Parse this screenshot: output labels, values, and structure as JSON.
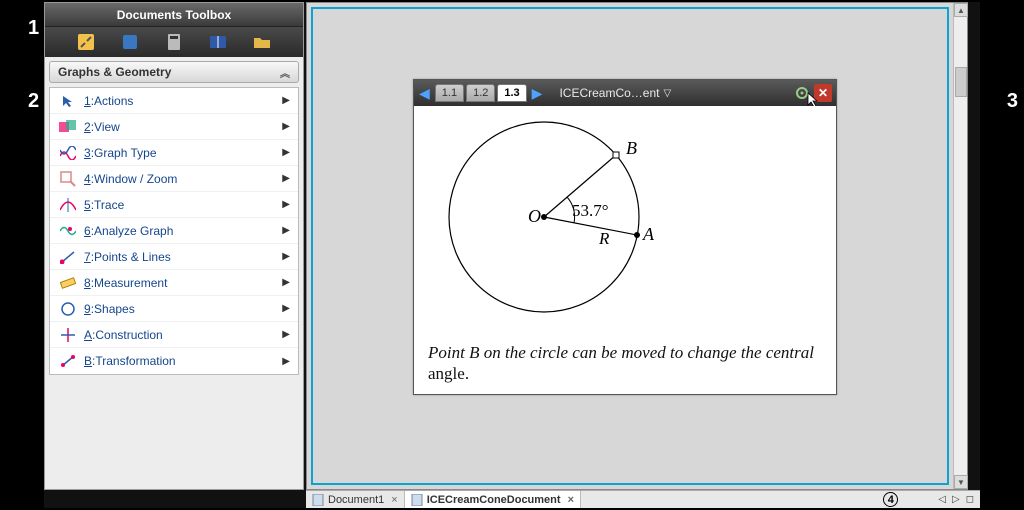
{
  "corners": {
    "n1": "1",
    "n2": "2",
    "n3": "3",
    "n4": "4"
  },
  "toolbox": {
    "title": "Documents Toolbox",
    "panel_title": "Graphs & Geometry",
    "items": [
      {
        "key": "1",
        "label": "Actions"
      },
      {
        "key": "2",
        "label": "View"
      },
      {
        "key": "3",
        "label": "Graph Type"
      },
      {
        "key": "4",
        "label": "Window / Zoom"
      },
      {
        "key": "5",
        "label": "Trace"
      },
      {
        "key": "6",
        "label": "Analyze Graph"
      },
      {
        "key": "7",
        "label": "Points & Lines"
      },
      {
        "key": "8",
        "label": "Measurement"
      },
      {
        "key": "9",
        "label": "Shapes"
      },
      {
        "key": "A",
        "label": "Construction"
      },
      {
        "key": "B",
        "label": "Transformation"
      }
    ]
  },
  "docwindow": {
    "tabs": [
      "1.1",
      "1.2",
      "1.3"
    ],
    "active_tab": "1.3",
    "doc_title": "ICECreamCo…ent",
    "geometry": {
      "center_label": "O",
      "point_a": "A",
      "point_b": "B",
      "radius_label": "R",
      "angle_text": "53.7°"
    },
    "instruction_italic": "Point B on the circle can be moved to change the central",
    "instruction_plain": " angle."
  },
  "doctabs": {
    "tab1": "Document1",
    "tab2": "ICECreamConeDocument"
  },
  "badge4": "4"
}
